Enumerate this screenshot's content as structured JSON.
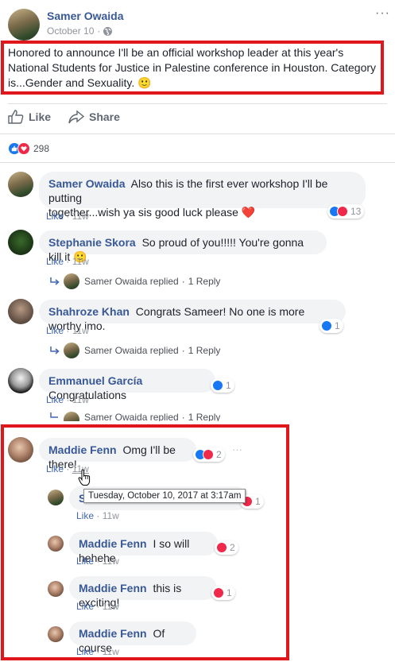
{
  "post": {
    "author": "Samer Owaida",
    "date": "October 10",
    "separator": "·",
    "text": "Honored to announce I'll be an official workshop leader at this year's National Students for Justice in Palestine conference in Houston. Category is...Gender and Sexuality.",
    "emoji": "🙂",
    "more": "···"
  },
  "actions": {
    "like": "Like",
    "share": "Share"
  },
  "reactions": {
    "count": "298"
  },
  "comments": [
    {
      "author": "Samer Owaida",
      "text_line1": "Also this is the first ever workshop I'll be putting",
      "text_line2": "together...wish ya sis good luck please",
      "emoji": "❤️",
      "like": "Like",
      "dot": "·",
      "time": "11w",
      "reactions": "13"
    },
    {
      "author": "Stephanie Skora",
      "text": "So proud of you!!!!! You're gonna kill it",
      "emoji": "🙂",
      "like": "Like",
      "dot": "·",
      "time": "11w",
      "reply_author": "Samer Owaida replied",
      "reply_dot": "·",
      "reply_count": "1 Reply"
    },
    {
      "author": "Shahroze Khan",
      "text": "Congrats Sameer! No one is more worthy imo.",
      "like": "Like",
      "dot": "·",
      "time": "11w",
      "reactions": "1",
      "reply_author": "Samer Owaida replied",
      "reply_dot": "·",
      "reply_count": "1 Reply"
    },
    {
      "author": "Emmanuel García",
      "text": "Congratulations",
      "like": "Like",
      "dot": "·",
      "time": "11w",
      "reactions": "1",
      "reply_author": "Samer Owaida replied",
      "reply_dot": "·",
      "reply_count": "1 Reply"
    },
    {
      "author": "Maddie Fenn",
      "text": "Omg I'll be there!",
      "like": "Like",
      "dot": "·",
      "time": "11w",
      "reactions": "2",
      "more": "···"
    }
  ],
  "tooltip": "Tuesday, October 10, 2017 at 3:17am",
  "replies": [
    {
      "author": "S",
      "like": "Like",
      "dot": "·",
      "time": "11w",
      "reactions": "1"
    },
    {
      "author": "Maddie Fenn",
      "text": "I so will hehehe",
      "like": "Like",
      "dot": "·",
      "time": "11w",
      "reactions": "2"
    },
    {
      "author": "Maddie Fenn",
      "text": "this is exciting!",
      "like": "Like",
      "dot": "·",
      "time": "11w",
      "reactions": "1"
    },
    {
      "author": "Maddie Fenn",
      "text": "Of course",
      "like": "Like",
      "dot": "·",
      "time": "11w"
    }
  ],
  "colors": {
    "link_blue": "#385898",
    "like_blue": "#1877f2",
    "love_red": "#f0284a",
    "highlight_red": "#e0161d",
    "bubble_gray": "#f2f3f5"
  }
}
